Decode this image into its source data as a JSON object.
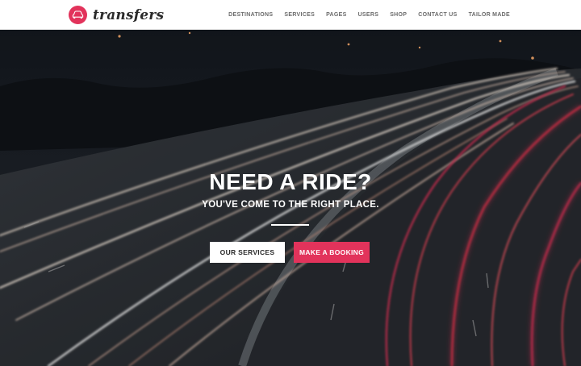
{
  "brand": {
    "logo_text": "transfers",
    "accent": "#e2335b",
    "icon": "car-icon"
  },
  "nav": {
    "items": [
      {
        "label": "DESTINATIONS"
      },
      {
        "label": "SERVICES"
      },
      {
        "label": "PAGES"
      },
      {
        "label": "USERS"
      },
      {
        "label": "SHOP"
      },
      {
        "label": "CONTACT US"
      },
      {
        "label": "TAILOR MADE"
      }
    ]
  },
  "hero": {
    "title": "NEED A RIDE?",
    "subtitle": "YOU'VE COME TO THE RIGHT PLACE.",
    "primary_button": "OUR SERVICES",
    "secondary_button": "MAKE A BOOKING",
    "background": "night-highway-light-trails"
  }
}
